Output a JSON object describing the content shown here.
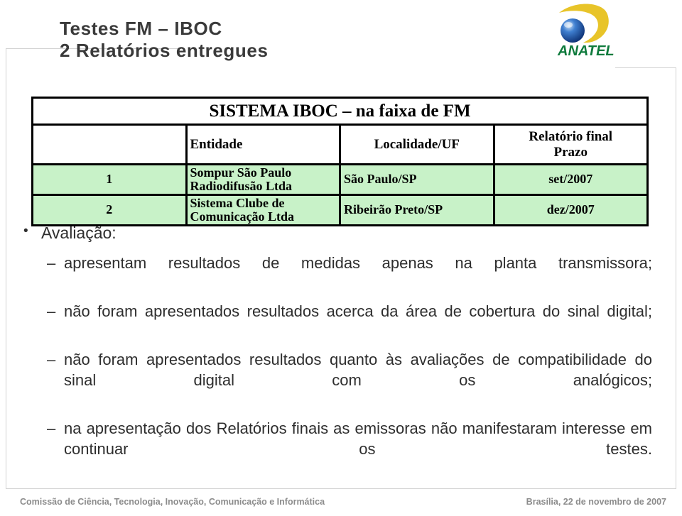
{
  "slide": {
    "title_lines": [
      "Testes FM – IBOC",
      "2 Relatórios entregues"
    ],
    "title_color": "#3a3a3a"
  },
  "logo": {
    "name": "anatel-logo",
    "wordmark": "ANATEL",
    "colors": {
      "crescent": "#e8c429",
      "sphere": "#1a4fa0",
      "wordmark": "#0e7a3c"
    }
  },
  "table": {
    "caption": "SISTEMA IBOC – na faixa de FM",
    "columns": [
      {
        "key": "num",
        "label": ""
      },
      {
        "key": "entidade",
        "label": "Entidade"
      },
      {
        "key": "localidade",
        "label": "Localidade/UF"
      },
      {
        "key": "relatorio",
        "label": "Relatório final\nPrazo"
      }
    ],
    "header_relatorio_line1": "Relatório final",
    "header_relatorio_line2": "Prazo",
    "row_background": "#c8f2c8",
    "rows": [
      {
        "num": "1",
        "entidade": "Sompur São Paulo Radiodifusão Ltda",
        "localidade": "São Paulo/SP",
        "relatorio": "set/2007"
      },
      {
        "num": "2",
        "entidade": "Sistema Clube de Comunicação Ltda",
        "localidade": "Ribeirão Preto/SP",
        "relatorio": "dez/2007"
      }
    ]
  },
  "body": {
    "heading": {
      "marker": "•",
      "text": "Avaliação:"
    },
    "items": [
      {
        "marker": "–",
        "text": "apresentam resultados de medidas apenas na planta transmissora;"
      },
      {
        "marker": "–",
        "text": "não foram apresentados resultados acerca da área de cobertura do sinal digital;"
      },
      {
        "marker": "–",
        "text": "não foram apresentados resultados quanto às avaliações de compatibilidade do sinal digital com os analógicos;"
      },
      {
        "marker": "–",
        "text": "na apresentação dos Relatórios finais as emissoras não manifestaram interesse em continuar os testes."
      }
    ]
  },
  "footer": {
    "left": "Comissão de Ciência, Tecnologia, Inovação, Comunicação e Informática",
    "right": "Brasília, 22 de novembro de 2007",
    "color": "#8c8c8c"
  }
}
